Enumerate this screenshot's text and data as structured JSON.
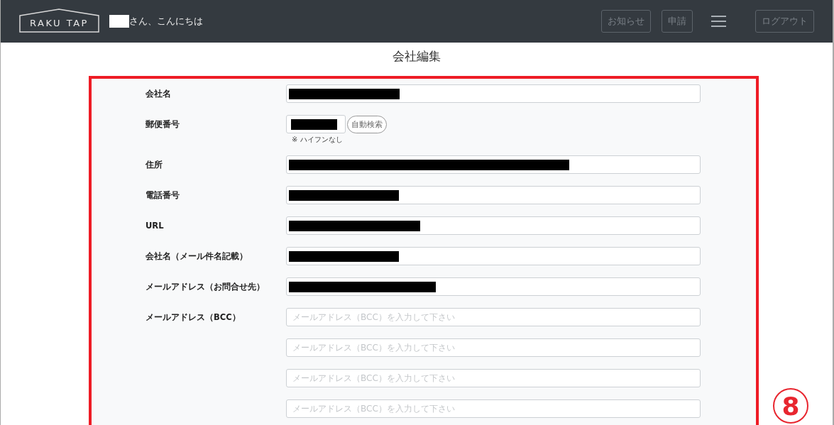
{
  "header": {
    "logo": "RAKU TAP",
    "greeting": "さん、こんにちは",
    "buttons": [
      {
        "label": "お知らせ",
        "kind": "text"
      },
      {
        "label": "申請",
        "kind": "text"
      },
      {
        "kind": "menu"
      },
      {
        "label": "ログアウト",
        "kind": "text"
      }
    ]
  },
  "page_title": "会社編集",
  "fields": [
    {
      "label": "会社名",
      "kind": "redacted"
    },
    {
      "label": "郵便番号",
      "kind": "postal",
      "button": "自動検索",
      "hint": "※ ハイフンなし"
    },
    {
      "label": "住所",
      "kind": "redacted"
    },
    {
      "label": "電話番号",
      "kind": "redacted"
    },
    {
      "label": "URL",
      "kind": "redacted"
    },
    {
      "label": "会社名（メール件名記載）",
      "kind": "redacted"
    },
    {
      "label": "メールアドレス（お問合せ先）",
      "kind": "redacted"
    },
    {
      "label": "メールアドレス（BCC）",
      "kind": "empty",
      "placeholder": "メールアドレス（BCC）を入力して下さい"
    },
    {
      "kind": "empty",
      "placeholder": "メールアドレス（BCC）を入力して下さい"
    },
    {
      "kind": "empty",
      "placeholder": "メールアドレス（BCC）を入力して下さい"
    },
    {
      "kind": "empty",
      "placeholder": "メールアドレス（BCC）を入力して下さい"
    }
  ],
  "annotation": {
    "number": "8"
  }
}
